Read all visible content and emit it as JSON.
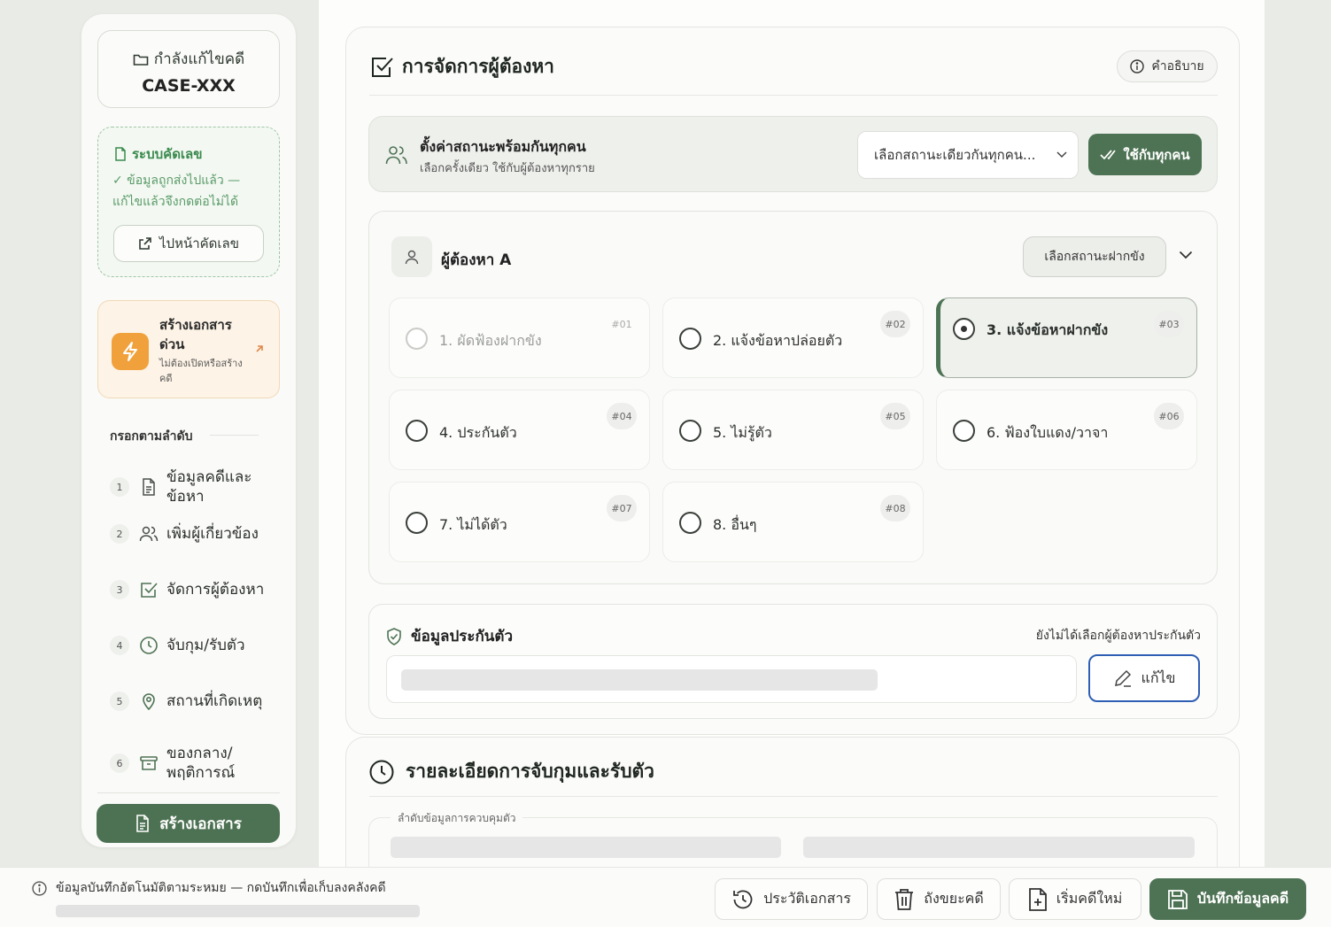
{
  "sidebar": {
    "case_label": "กำลังแก้ไขคดี",
    "case_id": "CASE-XXX",
    "numbering": {
      "title": "ระบบคัดเลข",
      "message": "✓ ข้อมูลถูกส่งไปแล้ว — แก้ไขแล้วจึงกดต่อไม่ได้",
      "button": "ไปหน้าคัดเลข"
    },
    "quick_doc": {
      "title": "สร้างเอกสารด่วน",
      "subtitle": "ไม่ต้องเปิดหรือสร้างคดี"
    },
    "steps_heading": "กรอกตามลำดับ",
    "steps": [
      {
        "num": "1",
        "label": "ข้อมูลคดีและข้อหา",
        "icon": "document-icon"
      },
      {
        "num": "2",
        "label": "เพิ่มผู้เกี่ยวข้อง",
        "icon": "users-icon"
      },
      {
        "num": "3",
        "label": "จัดการผู้ต้องหา",
        "icon": "checkbox-icon"
      },
      {
        "num": "4",
        "label": "จับกุม/รับตัว",
        "icon": "clock-icon"
      },
      {
        "num": "5",
        "label": "สถานที่เกิดเหตุ",
        "icon": "map-pin-icon"
      },
      {
        "num": "6",
        "label": "ของกลาง/พฤติการณ์",
        "icon": "archive-icon"
      }
    ],
    "create_button": "สร้างเอกสาร"
  },
  "panel": {
    "title": "การจัดการผู้ต้องหา",
    "help_button": "คำอธิบาย",
    "bulk": {
      "title": "ตั้งค่าสถานะพร้อมกันทุกคน",
      "subtitle": "เลือกครั้งเดียว ใช้กับผู้ต้องหาทุกราย",
      "select_placeholder": "เลือกสถานะเดียวกันทุกคน...",
      "apply_button": "ใช้กับทุกคน"
    },
    "suspect": {
      "name": "ผู้ต้องหา A",
      "status_button": "เลือกสถานะฝากขัง",
      "options": [
        {
          "label": "1. ผัดฟ้องฝากขัง",
          "code": "#01",
          "state": "disabled"
        },
        {
          "label": "2. แจ้งข้อหาปล่อยตัว",
          "code": "#02",
          "state": "normal"
        },
        {
          "label": "3. แจ้งข้อหาฝากขัง",
          "code": "#03",
          "state": "selected"
        },
        {
          "label": "4. ประกันตัว",
          "code": "#04",
          "state": "normal"
        },
        {
          "label": "5. ไม่รู้ตัว",
          "code": "#05",
          "state": "normal"
        },
        {
          "label": "6. ฟ้องใบแดง/วาจา",
          "code": "#06",
          "state": "normal"
        },
        {
          "label": "7. ไม่ได้ตัว",
          "code": "#07",
          "state": "normal"
        },
        {
          "label": "8. อื่นๆ",
          "code": "#08",
          "state": "normal"
        }
      ]
    },
    "bail": {
      "title": "ข้อมูลประกันตัว",
      "note": "ยังไม่ได้เลือกผู้ต้องหาประกันตัว",
      "edit_button": "แก้ไข"
    }
  },
  "panel2": {
    "title": "รายละเอียดการจับกุมและรับตัว",
    "sub_label": "ลำดับข้อมูลการควบคุมตัว"
  },
  "footer": {
    "note": "ข้อมูลบันทึกอัตโนมัติตามระหมย — กดบันทึกเพื่อเก็บลงคลังคดี",
    "buttons": {
      "history": "ประวัติเอกสาร",
      "trash": "ถังขยะคดี",
      "new_case": "เริ่มคดีใหม่",
      "save": "บันทึกข้อมูลคดี"
    }
  },
  "colors": {
    "primary_green": "#4e7354",
    "accent_orange": "#f0a13c",
    "edit_border_blue": "#2f5fb4",
    "numbering_green": "#3b8a4e"
  }
}
